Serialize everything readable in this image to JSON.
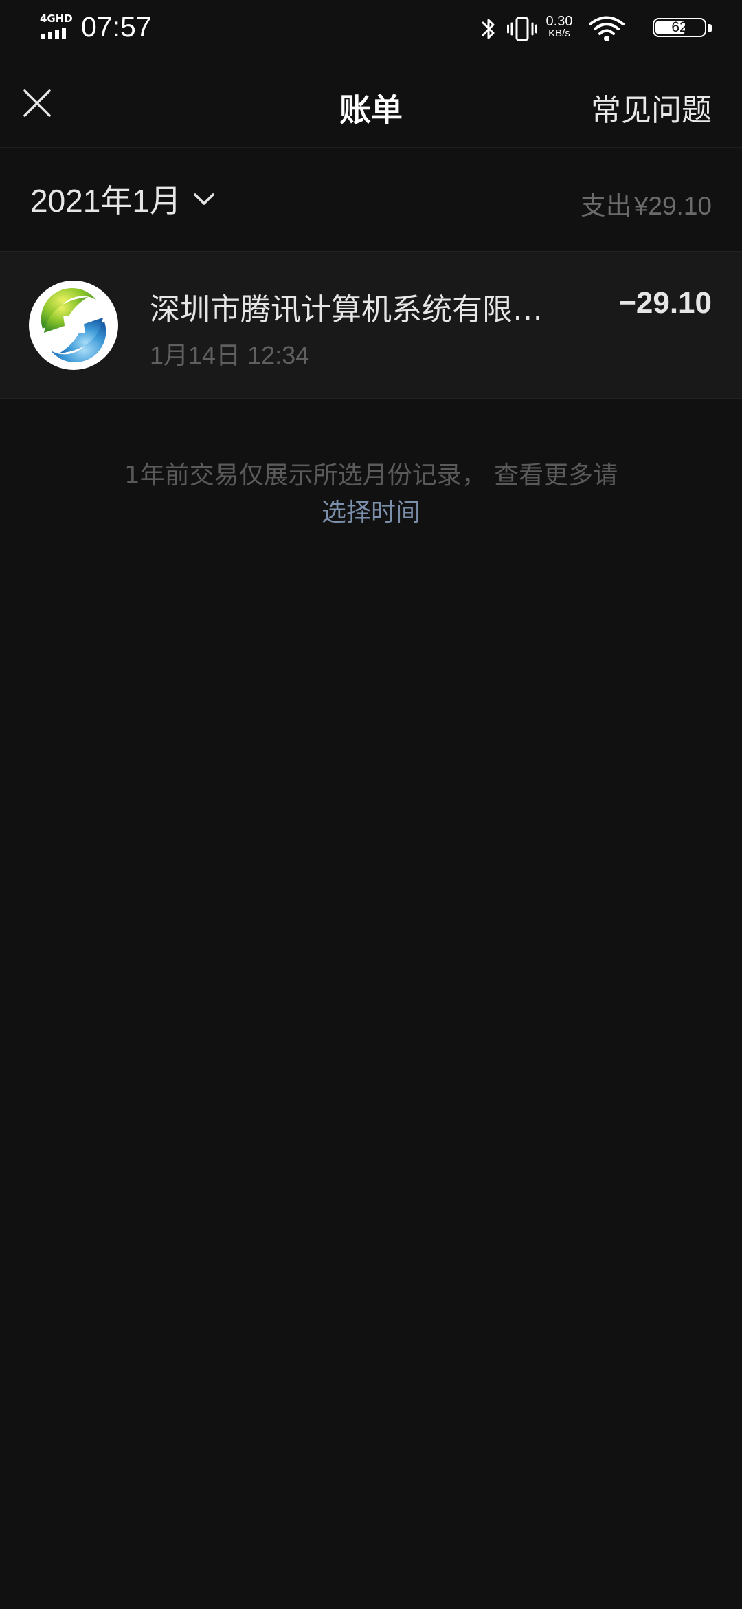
{
  "status_bar": {
    "network": "4GHD",
    "time": "07:57",
    "speed_value": "0.30",
    "speed_unit": "KB/s",
    "battery": "62",
    "battery_level": 0.62
  },
  "nav": {
    "title": "账单",
    "faq_label": "常见问题",
    "close_icon": "close-icon"
  },
  "month_header": {
    "month": "2021年1月",
    "total_label": "支出",
    "total_value": "¥29.10",
    "chevron_icon": "chevron-down-icon"
  },
  "transactions": [
    {
      "merchant": "深圳市腾讯计算机系统有限…",
      "time": "1月14日 12:34",
      "amount": "−29.10",
      "icon": "merchant-logo"
    }
  ],
  "footer": {
    "note": "1年前交易仅展示所选月份记录， 查看更多请",
    "link": "选择时间",
    "link_color": "#7b8fab"
  },
  "colors": {
    "background": "#111111",
    "row_background": "#191919"
  }
}
